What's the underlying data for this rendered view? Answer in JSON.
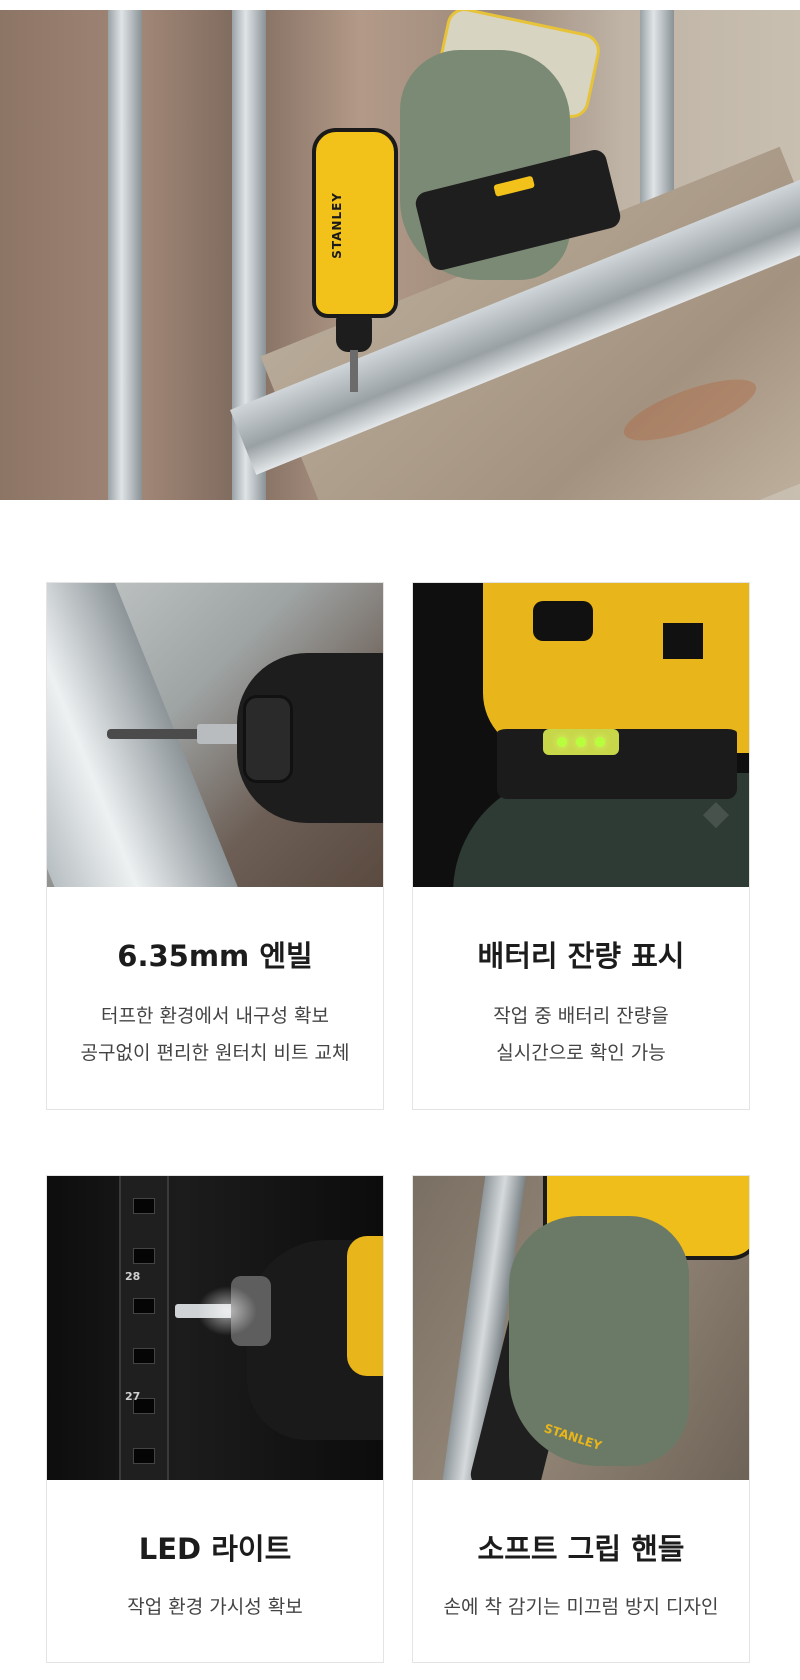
{
  "hero": {
    "image_alt_icon": "impact-driver-photo",
    "brand_mark": "STANLEY"
  },
  "features": [
    {
      "title": "6.35mm 엔빌",
      "lines": [
        "터프한 환경에서 내구성 확보",
        "공구없이 편리한 원터치 비트 교체"
      ]
    },
    {
      "title": "배터리 잔량 표시",
      "lines": [
        "작업 중 배터리 잔량을",
        "실시간으로 확인 가능"
      ]
    },
    {
      "title": "LED 라이트",
      "lines": [
        "작업 환경 가시성 확보"
      ]
    },
    {
      "title": "소프트 그립 핸들",
      "lines": [
        "손에 착 감기는 미끄럼 방지 디자인"
      ]
    }
  ],
  "photo_labels": {
    "rack_num_top": "28",
    "rack_num_bottom": "27",
    "grip_brand": "STANLEY"
  },
  "colors": {
    "brand_yellow": "#f2c21a",
    "tool_black": "#1a1a1a",
    "card_border": "#e4e4e4"
  }
}
